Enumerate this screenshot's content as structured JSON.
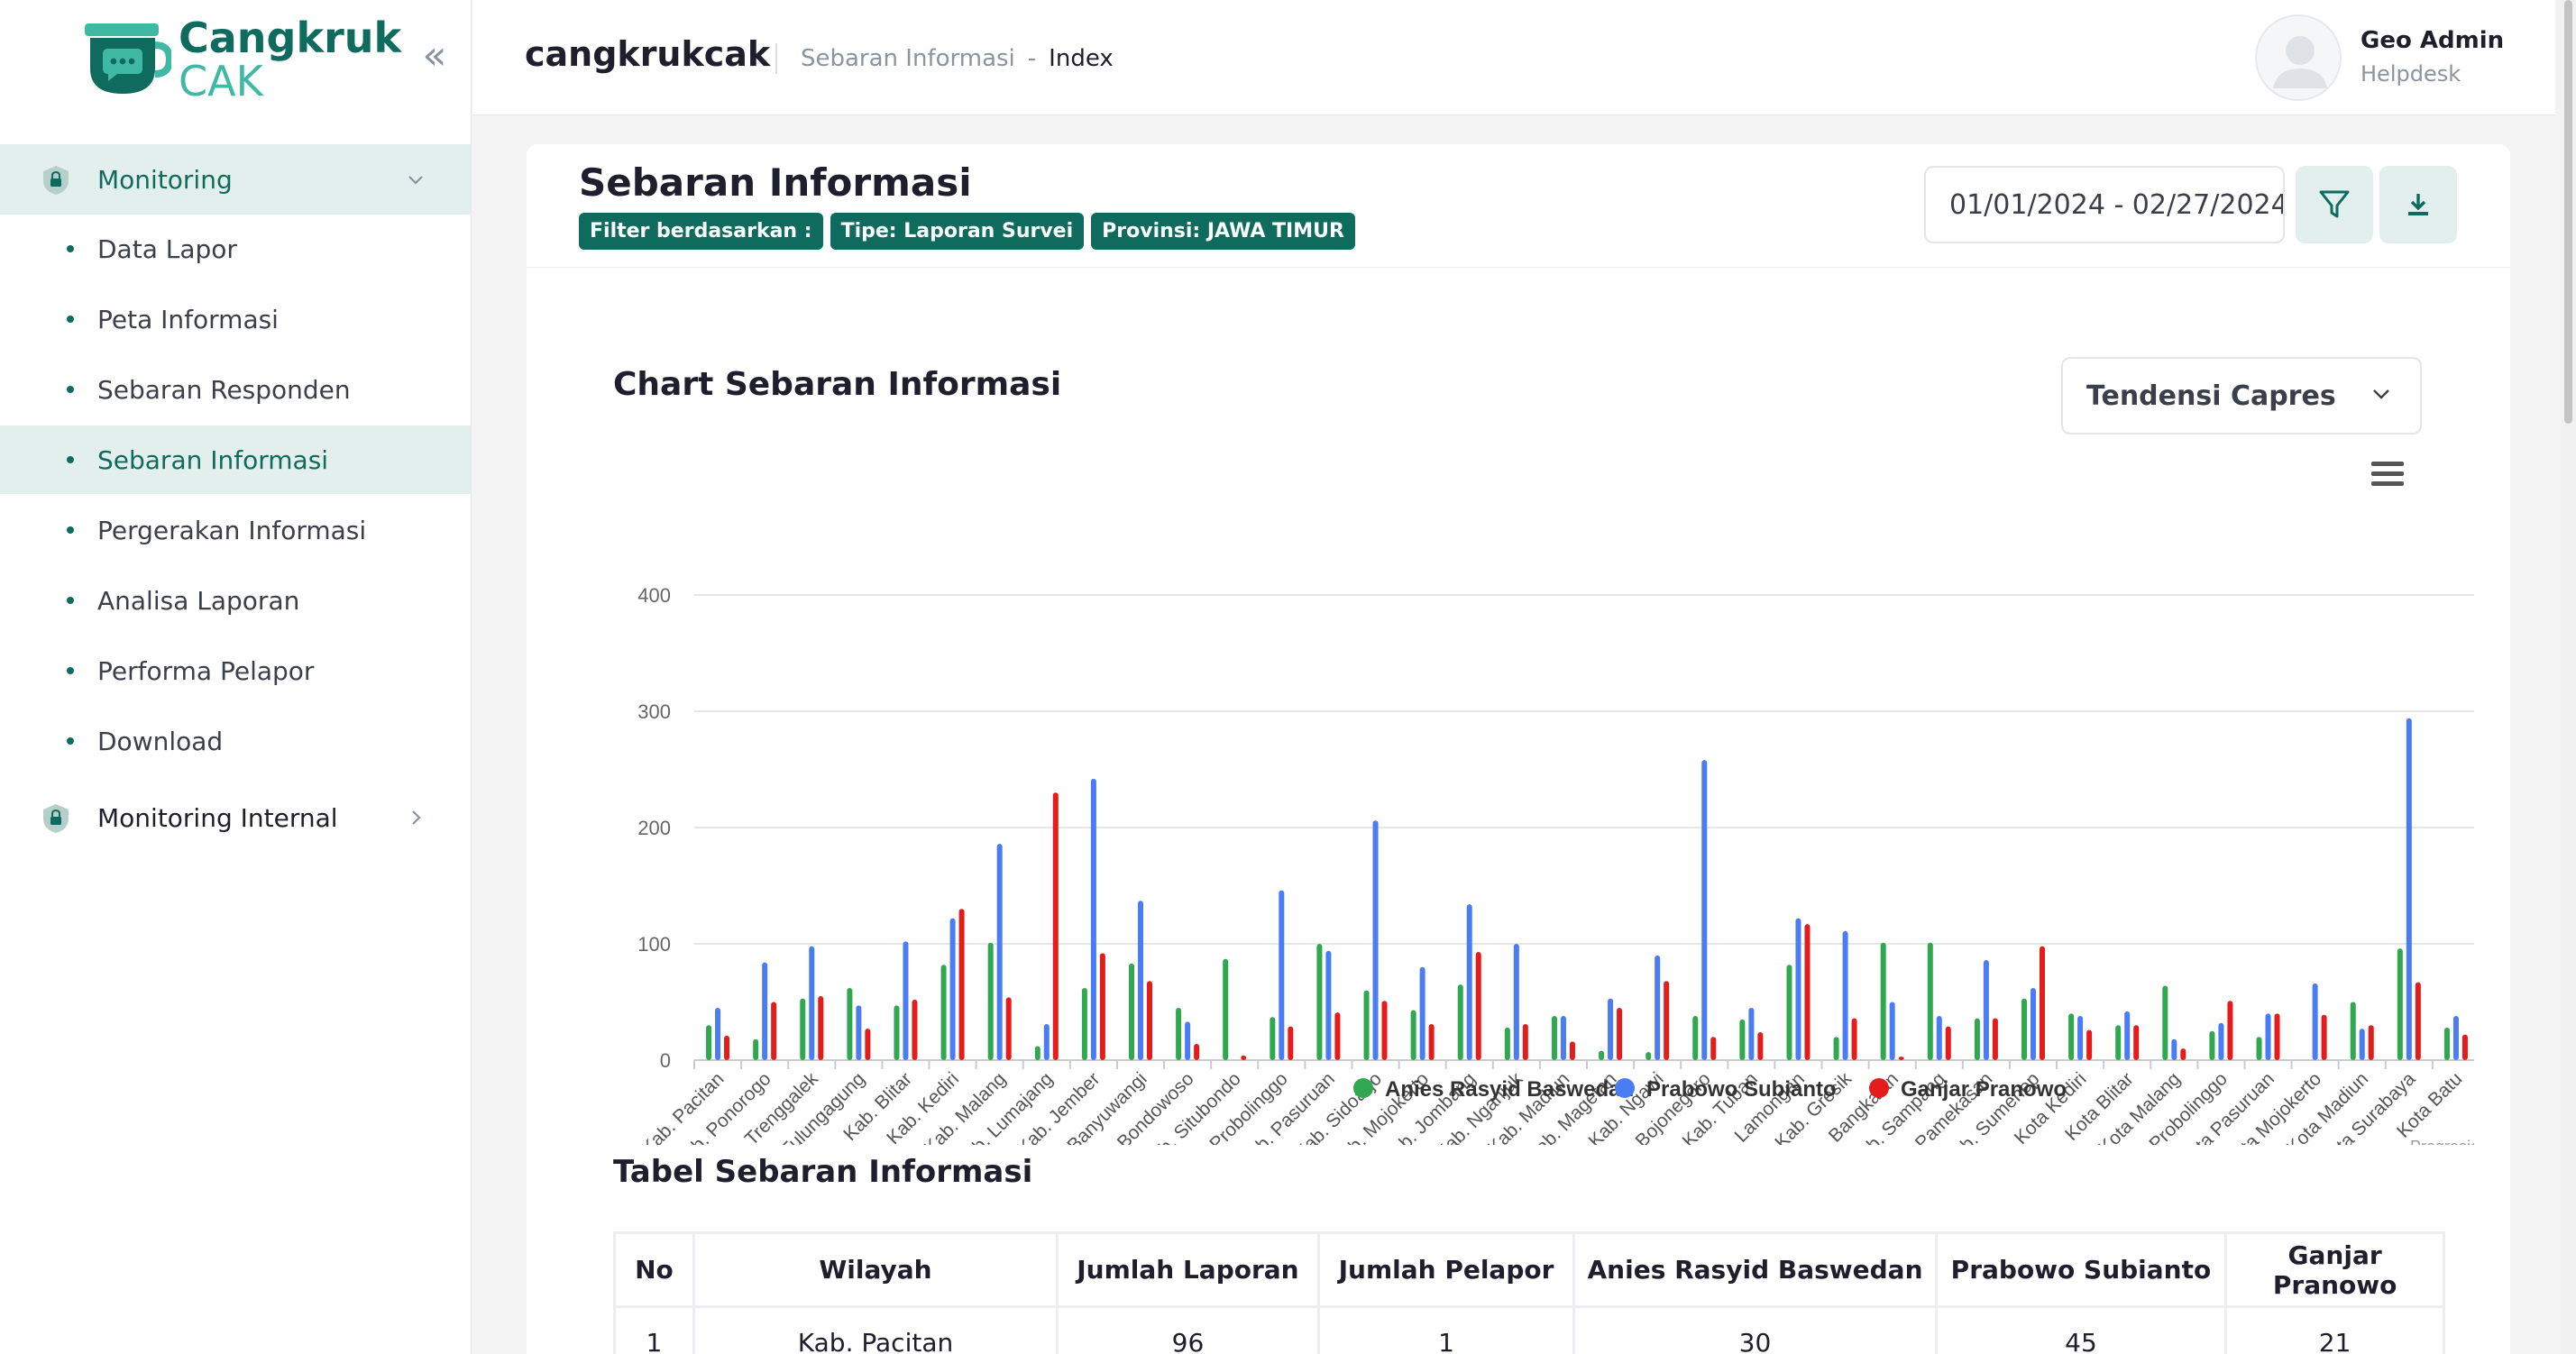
{
  "sidebar": {
    "logo": {
      "line1": "Cangkruk",
      "line2": "CAK"
    },
    "groups": [
      {
        "label": "Monitoring",
        "expanded": true
      },
      {
        "label": "Monitoring Internal",
        "expanded": false
      }
    ],
    "items": [
      {
        "label": "Data Lapor"
      },
      {
        "label": "Peta Informasi"
      },
      {
        "label": "Sebaran Responden"
      },
      {
        "label": "Sebaran Informasi",
        "active": true
      },
      {
        "label": "Pergerakan Informasi"
      },
      {
        "label": "Analisa Laporan"
      },
      {
        "label": "Performa Pelapor"
      },
      {
        "label": "Download"
      }
    ]
  },
  "header": {
    "brand": "cangkrukcak",
    "breadcrumb": {
      "parent": "Sebaran Informasi",
      "separator": "-",
      "current": "Index"
    },
    "user": {
      "name": "Geo Admin",
      "role": "Helpdesk"
    }
  },
  "page": {
    "title": "Sebaran Informasi",
    "filters": {
      "label": "Filter berdasarkan :",
      "type": "Tipe: Laporan Survei",
      "province": "Provinsi: JAWA TIMUR"
    },
    "date_range": "01/01/2024 - 02/27/2024",
    "chart_title": "Chart Sebaran Informasi",
    "category_select": "Tendensi Capres",
    "credit": "Progresio",
    "table_title": "Tabel Sebaran Informasi"
  },
  "colors": {
    "accent": "#0f6b5e",
    "accent_light": "#e3efec",
    "series": [
      "#2fa84f",
      "#4a7cf3",
      "#e51c1c"
    ]
  },
  "chart_data": {
    "type": "bar",
    "categories": [
      "Kab. Pacitan",
      "Kab. Ponorogo",
      "Kab. Trenggalek",
      "Kab. Tulungagung",
      "Kab. Blitar",
      "Kab. Kediri",
      "Kab. Malang",
      "Kab. Lumajang",
      "Kab. Jember",
      "Kab. Banyuwangi",
      "Kab. Bondowoso",
      "Kab. Situbondo",
      "Kab. Probolinggo",
      "Kab. Pasuruan",
      "Kab. Sidoarjo",
      "Kab. Mojokerto",
      "Kab. Jombang",
      "Kab. Nganjuk",
      "Kab. Madiun",
      "Kab. Magetan",
      "Kab. Ngawi",
      "Kab. Bojonegoro",
      "Kab. Tuban",
      "Kab. Lamongan",
      "Kab. Gresik",
      "Kab. Bangkalan",
      "Kab. Sampang",
      "Kab. Pamekasan",
      "Kab. Sumenep",
      "Kota Kediri",
      "Kota Blitar",
      "Kota Malang",
      "Kota Probolinggo",
      "Kota Pasuruan",
      "Kota Mojokerto",
      "Kota Madiun",
      "Kota Surabaya",
      "Kota Batu"
    ],
    "series": [
      {
        "name": "Anies Rasyid Baswedan",
        "color": "#2fa84f",
        "values": [
          30,
          18,
          53,
          62,
          47,
          82,
          101,
          12,
          62,
          83,
          45,
          87,
          37,
          100,
          60,
          43,
          65,
          28,
          38,
          8,
          7,
          38,
          35,
          82,
          20,
          101,
          101,
          36,
          53,
          40,
          30,
          64,
          25,
          20,
          0,
          50,
          96,
          28
        ]
      },
      {
        "name": "Prabowo Subianto",
        "color": "#4a7cf3",
        "values": [
          45,
          84,
          98,
          47,
          102,
          122,
          186,
          31,
          242,
          137,
          33,
          0,
          146,
          94,
          206,
          80,
          134,
          100,
          38,
          53,
          90,
          258,
          45,
          122,
          111,
          50,
          38,
          86,
          62,
          38,
          42,
          18,
          32,
          40,
          66,
          27,
          294,
          38
        ]
      },
      {
        "name": "Ganjar Pranowo",
        "color": "#e51c1c",
        "values": [
          21,
          50,
          55,
          27,
          52,
          130,
          54,
          230,
          92,
          68,
          14,
          4,
          29,
          41,
          51,
          31,
          93,
          31,
          16,
          45,
          68,
          20,
          24,
          117,
          36,
          3,
          29,
          36,
          98,
          26,
          30,
          10,
          51,
          40,
          39,
          30,
          67,
          22
        ]
      }
    ],
    "ylim": [
      0,
      400
    ],
    "yticks": [
      0,
      100,
      200,
      300,
      400
    ],
    "legend_position": "bottom-center",
    "grid": true
  },
  "table": {
    "headers": [
      "No",
      "Wilayah",
      "Jumlah Laporan",
      "Jumlah Pelapor",
      "Anies Rasyid Baswedan",
      "Prabowo Subianto",
      "Ganjar Pranowo"
    ],
    "rows": [
      [
        "1",
        "Kab. Pacitan",
        "96",
        "1",
        "30",
        "45",
        "21"
      ]
    ]
  }
}
